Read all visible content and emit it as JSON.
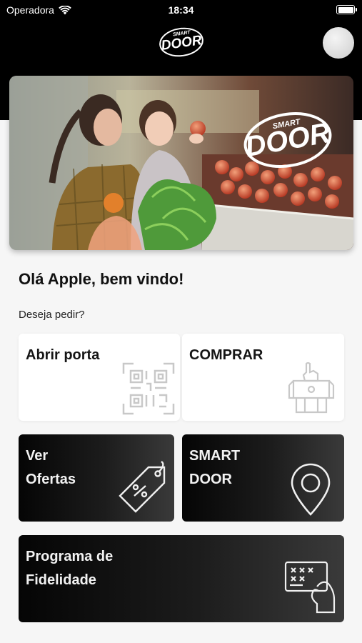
{
  "status_bar": {
    "carrier": "Operadora",
    "time": "18:34",
    "battery_level": 1.0
  },
  "header": {
    "logo": {
      "top_text": "SMART",
      "main_text": "DOOR"
    }
  },
  "banner": {
    "logo": {
      "top_text": "SMART",
      "main_text": "DOOR"
    }
  },
  "greeting": "Olá Apple, bem vindo!",
  "prompt": "Deseja pedir?",
  "cards": {
    "open_door": {
      "label": "Abrir porta",
      "icon": "qr-code-icon"
    },
    "buy": {
      "label": "COMPRAR",
      "icon": "vending-machine-icon"
    },
    "offers": {
      "line1": "Ver",
      "line2": "Ofertas",
      "icon": "price-tag-icon"
    },
    "smart_door": {
      "line1": "SMART",
      "line2": "DOOR",
      "icon": "location-pin-icon"
    },
    "loyalty": {
      "line1": "Programa de",
      "line2": "Fidelidade",
      "icon": "card-hand-icon"
    }
  }
}
